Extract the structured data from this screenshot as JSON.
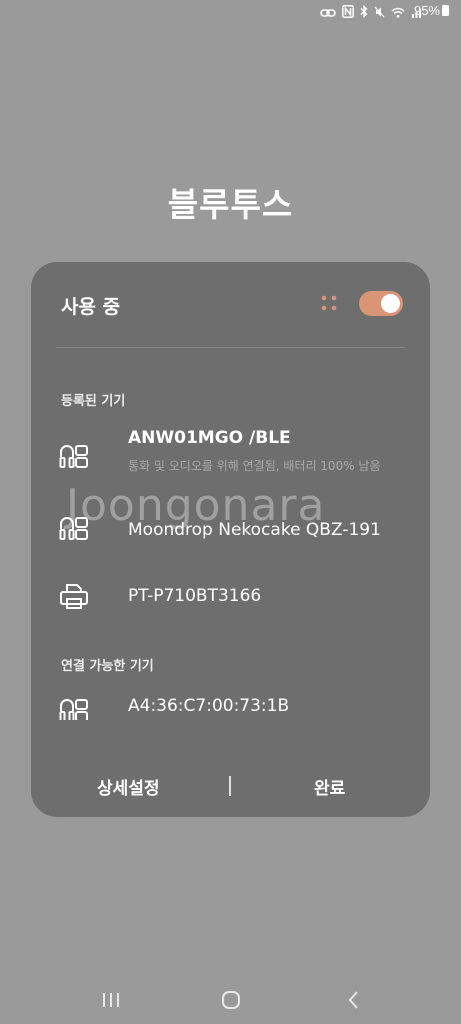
{
  "status_bar": {
    "battery": "95%",
    "icons": [
      "link-icon",
      "nfc-icon",
      "bluetooth-icon",
      "mute-icon",
      "wifi-icon",
      "signal-icon",
      "battery-icon"
    ]
  },
  "page": {
    "title": "블루투스"
  },
  "dialog": {
    "usage_label": "사용 중",
    "toggle_on": true,
    "registered_section": "등록된 기기",
    "registered_devices": [
      {
        "name": "ANW01MGO /BLE",
        "status": "통화 및 오디오를 위해 연결됨, 배터리 100% 남음",
        "icon": "headset-icon"
      },
      {
        "name": "Moondrop Nekocake QBZ-191",
        "icon": "headset-icon"
      },
      {
        "name": "PT-P710BT3166",
        "icon": "printer-icon"
      }
    ],
    "available_section": "연결 가능한 기기",
    "available_devices": [
      {
        "name": "A4:36:C7:00:73:1B",
        "icon": "headset-icon"
      }
    ],
    "advanced_button": "상세설정",
    "done_button": "완료"
  },
  "watermark": "Joongonara",
  "colors": {
    "background": "#9a9a9a",
    "dialog": "#6e6e6e",
    "accent_toggle": "#d99575"
  }
}
